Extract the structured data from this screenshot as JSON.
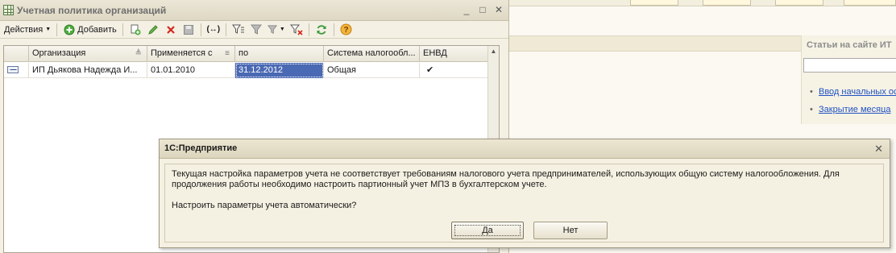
{
  "background": {
    "side_title": "Статьи на сайте ИТ",
    "links": [
      "Ввод начальных ос",
      "Закрытие месяца"
    ]
  },
  "form": {
    "title": "Учетная политика организаций",
    "controls": {
      "minimize": "_",
      "maximize": "□",
      "close": "✕"
    },
    "toolbar": {
      "actions_label": "Действия",
      "add_label": "Добавить",
      "icons": [
        "copy-icon",
        "edit-icon",
        "delete-icon",
        "save-icon",
        "brackets-icon",
        "filter-icon",
        "filter-list-icon",
        "filter-dropdown-icon",
        "clear-filter-icon",
        "refresh-icon",
        "help-icon"
      ]
    },
    "grid": {
      "columns": [
        "Организация",
        "Применяется с",
        "по",
        "Система налогообл...",
        "ЕНВД"
      ],
      "rows": [
        {
          "org": "ИП Дьякова Надежда И...",
          "from": "01.01.2010",
          "to": "31.12.2012",
          "system": "Общая",
          "envd": "✔"
        }
      ]
    }
  },
  "dialog": {
    "title": "1С:Предприятие",
    "message": "Текущая настройка параметров учета не соответствует требованиям налогового учета предпринимателей, использующих общую систему налогообложения. Для продолжения работы необходимо настроить партионный учет МПЗ в бухгалтерском учете.",
    "question": "Настроить параметры учета автоматически?",
    "yes_label": "Да",
    "no_label": "Нет"
  }
}
